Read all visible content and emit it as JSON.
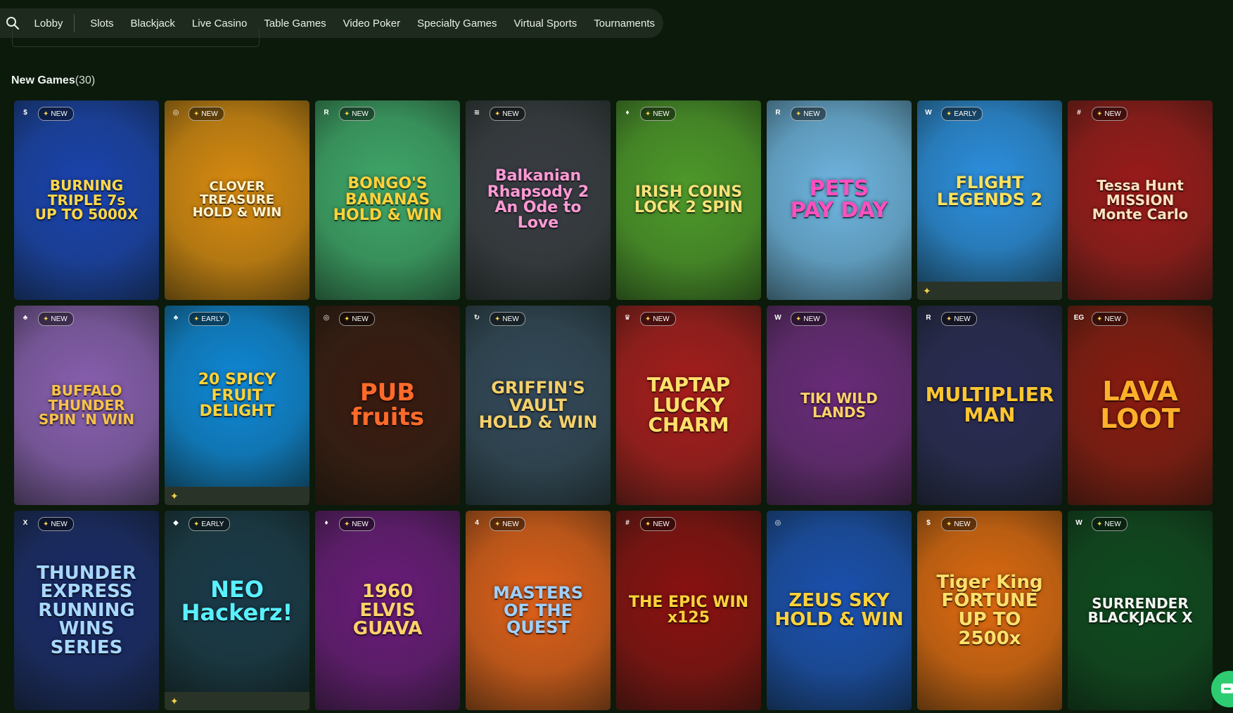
{
  "nav": {
    "search_icon": "search-icon",
    "items": [
      "Lobby",
      "Slots",
      "Blackjack",
      "Live Casino",
      "Table Games",
      "Video Poker",
      "Specialty Games",
      "Virtual Sports",
      "Tournaments"
    ]
  },
  "section": {
    "title": "New Games",
    "count": "(30)"
  },
  "games": [
    {
      "title": "BURNING\nTRIPLE 7s\nUP TO 5000X",
      "badge": "NEW",
      "bg": "#1a43b0",
      "fg": "#ffd84a",
      "logo": "$",
      "size": 20,
      "short": false
    },
    {
      "title": "CLOVER TREASURE\nHOLD & WIN",
      "badge": "NEW",
      "bg": "#d98b10",
      "fg": "#fff3cf",
      "logo": "◎",
      "size": 18,
      "short": false
    },
    {
      "title": "BONGO'S\nBANANAS\nHOLD & WIN",
      "badge": "NEW",
      "bg": "#3fa86a",
      "fg": "#ffd23a",
      "logo": "R",
      "size": 22,
      "short": false
    },
    {
      "title": "Balkanian\nRhapsody 2\nAn Ode to Love",
      "badge": "NEW",
      "bg": "#3a3d44",
      "fg": "#ff9ad6",
      "logo": "≋",
      "size": 22,
      "short": false
    },
    {
      "title": "IRISH COINS\nLOCK 2 SPIN",
      "badge": "NEW",
      "bg": "#4e9a2a",
      "fg": "#f7e27a",
      "logo": "♦",
      "size": 22,
      "short": false
    },
    {
      "title": "PETS\nPAY DAY",
      "badge": "NEW",
      "bg": "#6fb5e2",
      "fg": "#ff4fc0",
      "logo": "R",
      "size": 30,
      "short": false
    },
    {
      "title": "FLIGHT\nLEGENDS 2",
      "badge": "EARLY",
      "bg": "#2c8fe0",
      "fg": "#ffe25a",
      "logo": "W",
      "size": 24,
      "short": true
    },
    {
      "title": "Tessa Hunt\nMISSION\nMonte Carlo",
      "badge": "NEW",
      "bg": "#9c1a1a",
      "fg": "#ffe3c0",
      "logo": "#",
      "size": 20,
      "short": false
    },
    {
      "title": "BUFFALO\nTHUNDER\nSPIN 'N WIN",
      "badge": "NEW",
      "bg": "#8a5fb2",
      "fg": "#f6c24a",
      "logo": "♣",
      "size": 20,
      "short": false
    },
    {
      "title": "20 SPICY FRUIT\nDELIGHT",
      "badge": "EARLY",
      "bg": "#0e88d8",
      "fg": "#ffd23a",
      "logo": "♣",
      "size": 22,
      "short": true
    },
    {
      "title": "PUB\nfruits",
      "badge": "NEW",
      "bg": "#3a1a10",
      "fg": "#ff6a2a",
      "logo": "◎",
      "size": 34,
      "short": false
    },
    {
      "title": "GRIFFIN'S\nVAULT\nHOLD & WIN",
      "badge": "NEW",
      "bg": "#33485a",
      "fg": "#f4d06a",
      "logo": "↻",
      "size": 24,
      "short": false
    },
    {
      "title": "TAPTAP\nLUCKY\nCHARM",
      "badge": "NEW",
      "bg": "#a81c1c",
      "fg": "#ffe06a",
      "logo": "♛",
      "size": 28,
      "short": false
    },
    {
      "title": "TIKI WILD LANDS",
      "badge": "NEW",
      "bg": "#6a2a7a",
      "fg": "#ffd26a",
      "logo": "W",
      "size": 20,
      "short": false
    },
    {
      "title": "MULTIPLIER\nMAN",
      "badge": "NEW",
      "bg": "#2a2a55",
      "fg": "#ffc630",
      "logo": "R",
      "size": 28,
      "short": false
    },
    {
      "title": "LAVA\nLOOT",
      "badge": "NEW",
      "bg": "#8a1a10",
      "fg": "#ffb02a",
      "logo": "EG",
      "size": 38,
      "short": false
    },
    {
      "title": "THUNDER\nEXPRESS\nRUNNING WINS SERIES",
      "badge": "NEW",
      "bg": "#1a2a6a",
      "fg": "#a8d8ff",
      "logo": "X",
      "size": 26,
      "short": false
    },
    {
      "title": "NEO\nHackerz!",
      "badge": "EARLY",
      "bg": "#1a3a4a",
      "fg": "#5af0ff",
      "logo": "◆",
      "size": 32,
      "short": true
    },
    {
      "title": "1960\nELVIS GUAVA",
      "badge": "NEW",
      "bg": "#6a1a7a",
      "fg": "#ffd26a",
      "logo": "♦",
      "size": 26,
      "short": false
    },
    {
      "title": "MASTERS\nOF THE QUEST",
      "badge": "NEW",
      "bg": "#e0601a",
      "fg": "#9fd0ff",
      "logo": "4",
      "size": 24,
      "short": false
    },
    {
      "title": "THE EPIC WIN\nx125",
      "badge": "NEW",
      "bg": "#8a1010",
      "fg": "#ffd23a",
      "logo": "#",
      "size": 22,
      "short": false
    },
    {
      "title": "ZEUS SKY\nHOLD & WIN",
      "badge": "",
      "bg": "#1a50b0",
      "fg": "#ffd23a",
      "logo": "◎",
      "size": 26,
      "short": false
    },
    {
      "title": "Tiger King\nFORTUNE\nUP TO 2500x",
      "badge": "NEW",
      "bg": "#e06a10",
      "fg": "#ffe06a",
      "logo": "$",
      "size": 26,
      "short": false
    },
    {
      "title": "SURRENDER\nBLACKJACK X",
      "badge": "NEW",
      "bg": "#0f4a1f",
      "fg": "#f2f5f2",
      "logo": "W",
      "size": 20,
      "short": false
    }
  ],
  "colors": {
    "page_bg": "#0b1a0b",
    "nav_bg": "#1e2a1e",
    "chat_green": "#2ecc71"
  }
}
